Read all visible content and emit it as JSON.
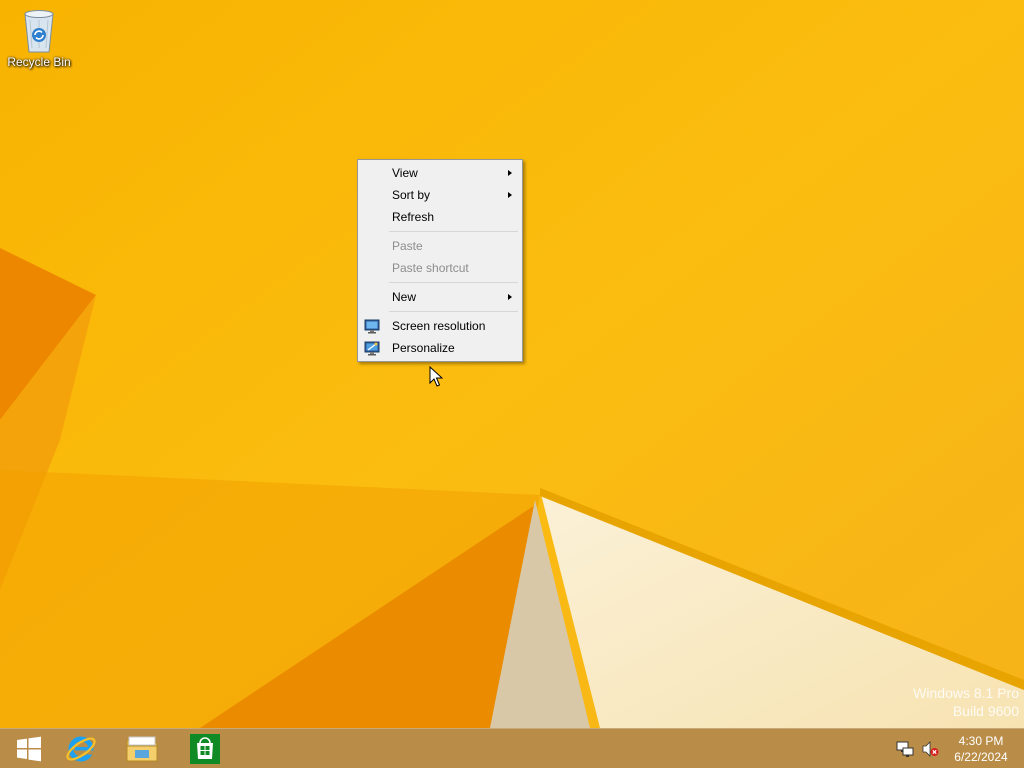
{
  "desktop": {
    "icons": [
      {
        "label": "Recycle Bin",
        "icon": "recycle-bin-icon"
      }
    ]
  },
  "context_menu": {
    "items": [
      {
        "label": "View",
        "submenu": true,
        "enabled": true
      },
      {
        "label": "Sort by",
        "submenu": true,
        "enabled": true
      },
      {
        "label": "Refresh",
        "submenu": false,
        "enabled": true
      },
      {
        "label": "Paste",
        "submenu": false,
        "enabled": false
      },
      {
        "label": "Paste shortcut",
        "submenu": false,
        "enabled": false
      },
      {
        "label": "New",
        "submenu": true,
        "enabled": true
      },
      {
        "label": "Screen resolution",
        "submenu": false,
        "enabled": true,
        "icon": "display-settings-icon"
      },
      {
        "label": "Personalize",
        "submenu": false,
        "enabled": true,
        "icon": "personalize-icon"
      }
    ]
  },
  "watermark": {
    "line1": "Windows 8.1 Pro",
    "line2": "Build 9600"
  },
  "taskbar": {
    "buttons": [
      {
        "name": "start-button",
        "icon": "windows-logo-icon"
      },
      {
        "name": "internet-explorer-button",
        "icon": "internet-explorer-icon"
      },
      {
        "name": "file-explorer-button",
        "icon": "file-explorer-icon"
      },
      {
        "name": "store-button",
        "icon": "store-icon"
      }
    ],
    "tray": {
      "icons": [
        "network-icon",
        "volume-muted-icon"
      ],
      "time": "4:30 PM",
      "date": "6/22/2024"
    }
  },
  "colors": {
    "wallpaper": "#f7b500",
    "taskbar": "#b98d48",
    "menu_background": "#f0f0f0",
    "disabled_text": "#8d8d8d"
  }
}
